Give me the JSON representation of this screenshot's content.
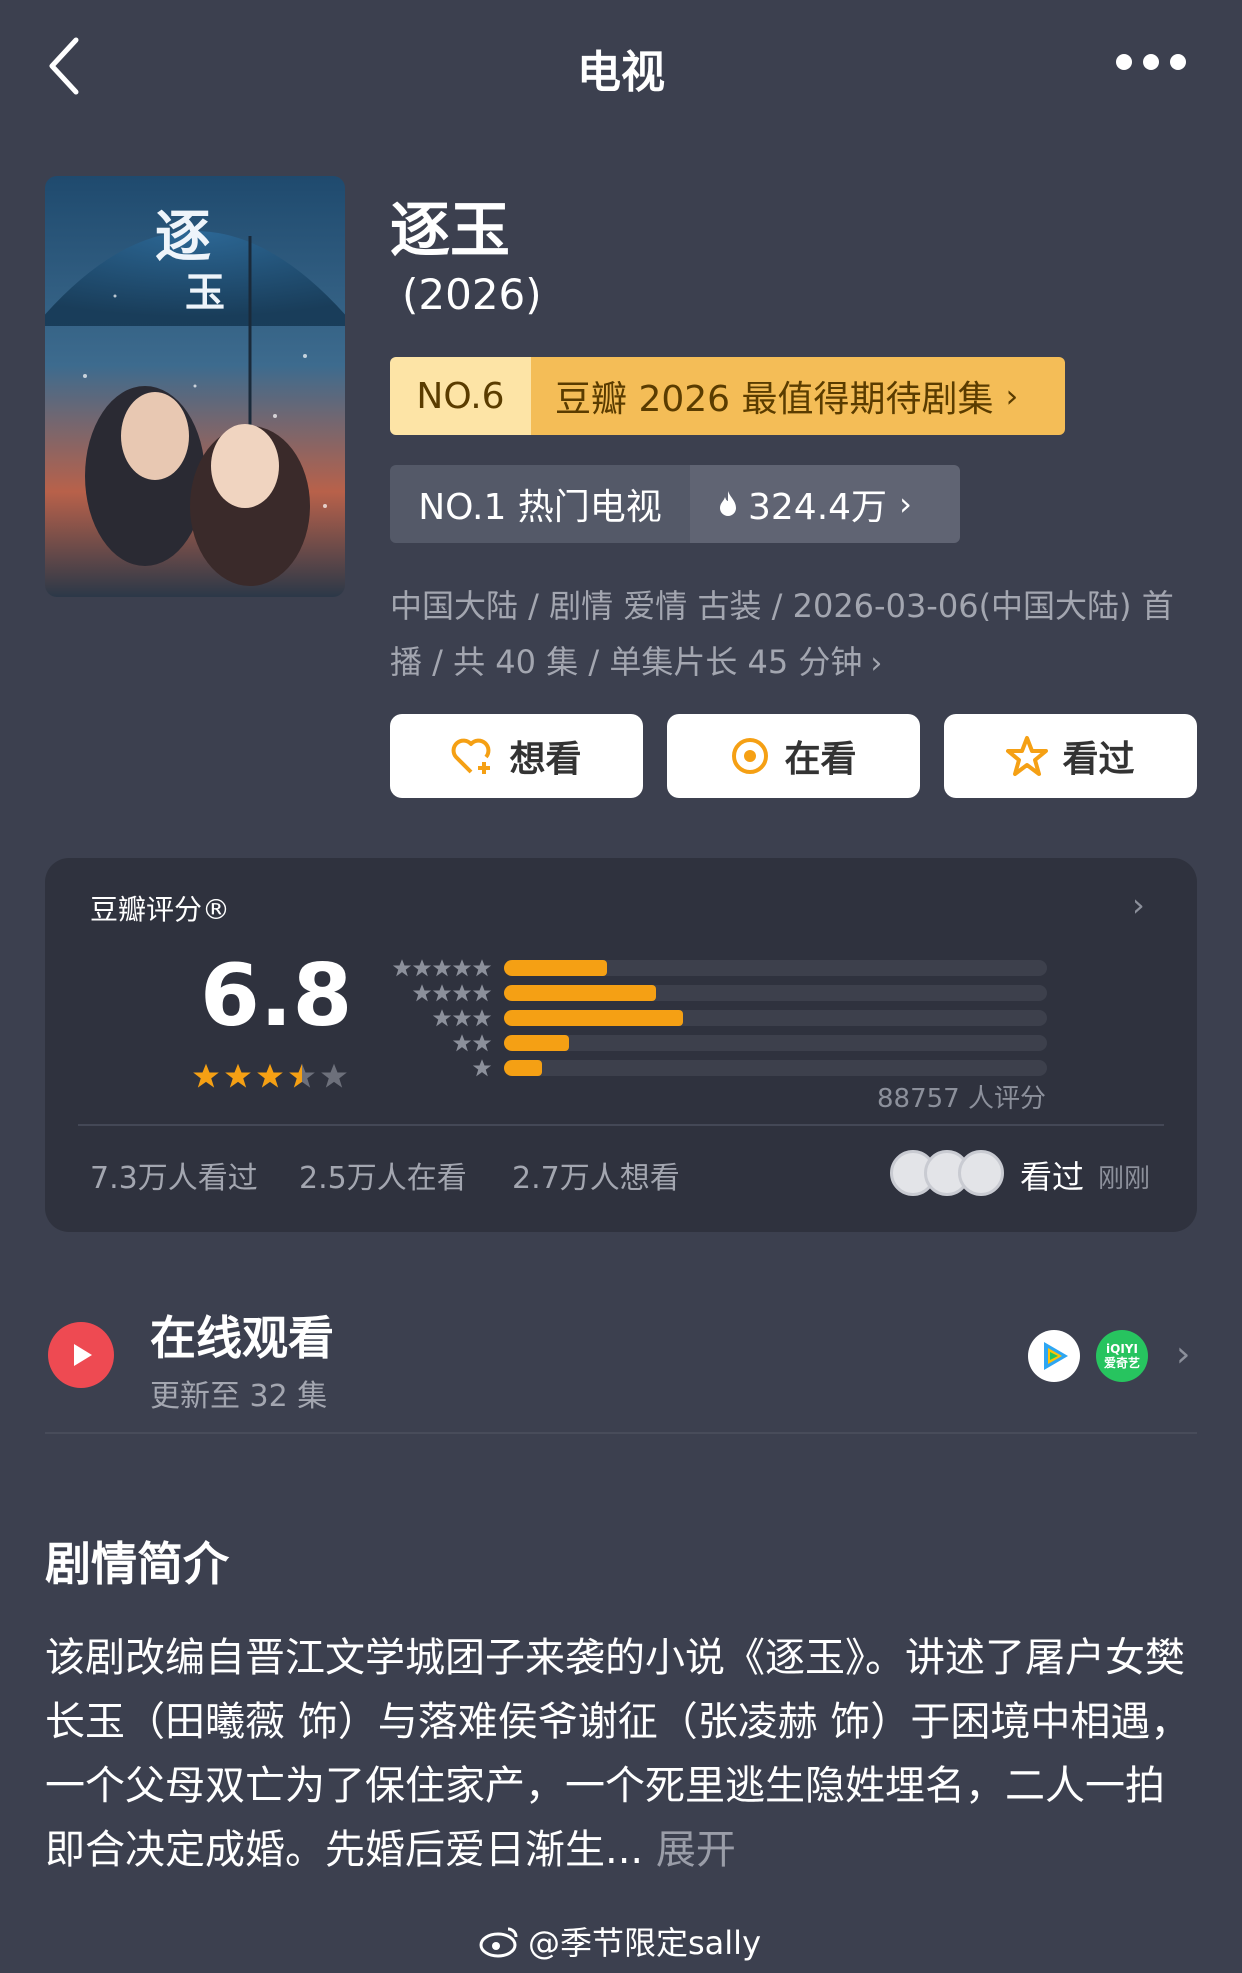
{
  "header": {
    "title": "电视"
  },
  "show": {
    "title": "逐玉",
    "year": "(2026)",
    "rank1": {
      "no": "NO.6",
      "text": "豆瓣 2026 最值得期待剧集"
    },
    "rank2": {
      "no": "NO.1 热门电视",
      "hot": "324.4万"
    },
    "meta": "中国大陆 / 剧情 爱情 古装 / 2026-03-06(中国大陆) 首播 / 共 40 集 / 单集片长 45 分钟"
  },
  "actions": {
    "want": "想看",
    "watching": "在看",
    "watched": "看过"
  },
  "rating": {
    "label": "豆瓣评分®",
    "score": "6.8",
    "stars": 3.5,
    "distribution": [
      {
        "stars": 5,
        "fraction": 0.19
      },
      {
        "stars": 4,
        "fraction": 0.28
      },
      {
        "stars": 3,
        "fraction": 0.33
      },
      {
        "stars": 2,
        "fraction": 0.12
      },
      {
        "stars": 1,
        "fraction": 0.07
      }
    ],
    "count": "88757 人评分",
    "watched_count": "7.3万人看过",
    "watching_count": "2.5万人在看",
    "want_count": "2.7万人想看",
    "recent_action": "看过",
    "recent_time": "刚刚"
  },
  "online": {
    "title": "在线观看",
    "subtitle": "更新至 32 集",
    "iqiyi_text": "iQIYI\n爱奇艺"
  },
  "synopsis": {
    "title": "剧情简介",
    "text": "该剧改编自晋江文学城团子来袭的小说《逐玉》。讲述了屠户女樊长玉（田曦薇 饰）与落难侯爷谢征（张凌赫 饰）于困境中相遇，一个父母双亡为了保住家产，一个死里逃生隐姓埋名，二人一拍即合决定成婚。先婚后爱日渐生...",
    "expand": "展开"
  },
  "watermark": "@季节限定sally",
  "colors": {
    "background": "#3c404f",
    "accent": "#f5a014",
    "card": "#2f323e"
  }
}
